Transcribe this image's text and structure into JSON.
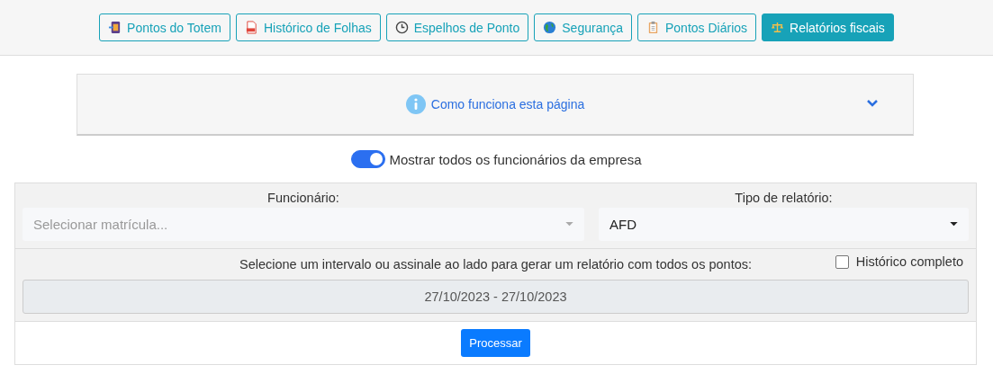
{
  "tabs": [
    {
      "label": "Pontos do Totem",
      "kind": "totem",
      "selected": false
    },
    {
      "label": "Histórico de Folhas",
      "kind": "pdf",
      "selected": false
    },
    {
      "label": "Espelhos de Ponto",
      "kind": "clock",
      "selected": false
    },
    {
      "label": "Segurança",
      "kind": "globe",
      "selected": false
    },
    {
      "label": "Pontos Diários",
      "kind": "clipboard",
      "selected": false
    },
    {
      "label": "Relatórios fiscais",
      "kind": "scales",
      "selected": true
    }
  ],
  "help": {
    "title": "Como funciona esta página",
    "expanded": false
  },
  "show_all": {
    "label": "Mostrar todos os funcionários da empresa",
    "on": true
  },
  "employee": {
    "label": "Funcionário:",
    "placeholder": "Selecionar matrícula..."
  },
  "report_type": {
    "label": "Tipo de relatório:",
    "value": "AFD"
  },
  "interval": {
    "label": "Selecione um intervalo ou assinale ao lado para gerar um relatório com todos os pontos:",
    "value": "27/10/2023 - 27/10/2023"
  },
  "full_history": {
    "label": "Histórico completo",
    "checked": false
  },
  "submit": "Processar"
}
